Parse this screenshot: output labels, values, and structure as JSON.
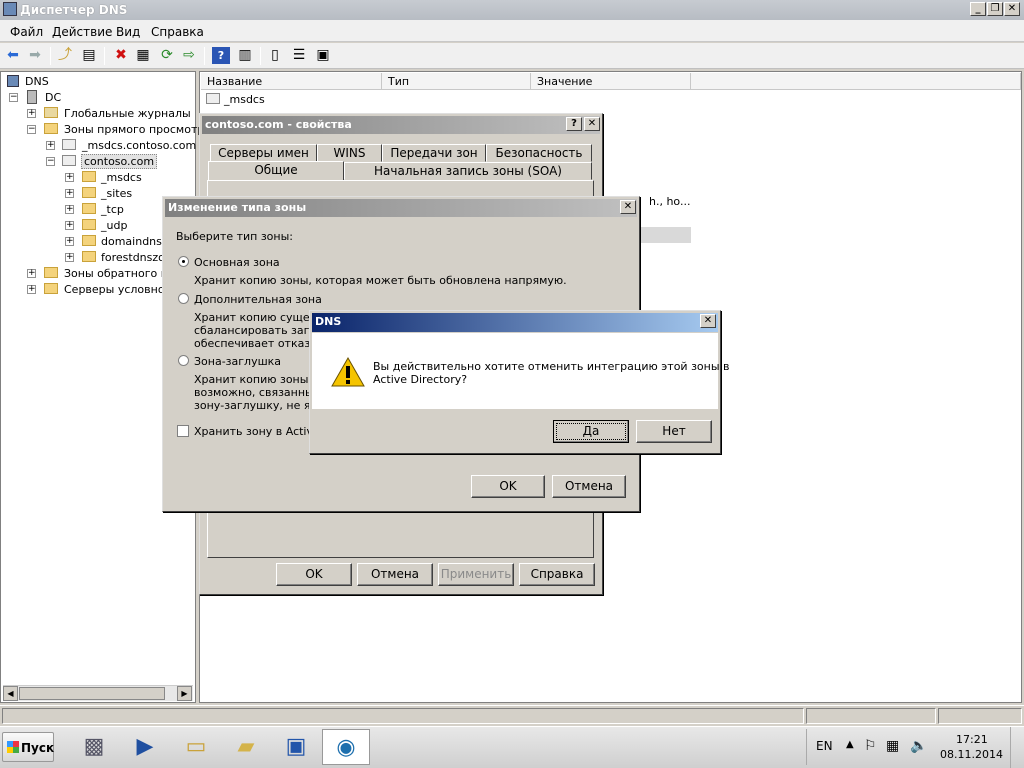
{
  "window": {
    "title": "Диспетчер DNS"
  },
  "menu": [
    "Файл",
    "Действие",
    "Вид",
    "Справка"
  ],
  "toolbar_icons": [
    "back-icon",
    "forward-icon",
    "up-folder-icon",
    "show-tree-icon",
    "delete-icon",
    "properties-icon",
    "refresh-icon",
    "export-icon",
    "help-icon",
    "view-icon",
    "server-icon",
    "list-icon",
    "record-icon"
  ],
  "tree": {
    "root": "DNS",
    "server": "DC",
    "global_logs": "Глобальные журналы",
    "forward_zones": "Зоны прямого просмотра",
    "msdcs_zone": "_msdcs.contoso.com",
    "contoso": "contoso.com",
    "children": [
      "_msdcs",
      "_sites",
      "_tcp",
      "_udp",
      "domaindnszo",
      "forestdnszor"
    ],
    "reverse_zones": "Зоны обратного про",
    "conditional": "Серверы условной"
  },
  "list": {
    "columns": [
      "Название",
      "Тип",
      "Значение"
    ],
    "rows": [
      {
        "name": "_msdcs"
      }
    ],
    "partial_value": "h., ho..."
  },
  "props_dialog": {
    "title": "contoso.com - свойства",
    "help": "?",
    "close": "✕",
    "tabs_top": [
      "Серверы имен",
      "WINS",
      "Передачи зон",
      "Безопасность"
    ],
    "tabs_bottom": [
      "Общие",
      "Начальная запись зоны (SOA)"
    ],
    "ok": "OK",
    "cancel": "Отмена",
    "apply": "Применить",
    "help_btn": "Справка"
  },
  "zone_dialog": {
    "title": "Изменение типа зоны",
    "close": "✕",
    "prompt": "Выберите тип зоны:",
    "primary": "Основная зона",
    "primary_desc": "Хранит копию зоны, которая может быть обновлена напрямую.",
    "secondary": "Дополнительная зона",
    "secondary_desc": [
      "Хранит копию существ",
      "сбалансировать загру:",
      "обеспечивает отказоу"
    ],
    "stub": "Зона-заглушка",
    "stub_desc": [
      "Хранит копию зоны, со",
      "возможно, связанные ;",
      "зону-заглушку, не явл"
    ],
    "store_ad": "Хранить зону в Active I",
    "ok": "OK",
    "cancel": "Отмена"
  },
  "confirm": {
    "title": "DNS",
    "close": "✕",
    "message_1": "Вы действительно хотите отменить интеграцию этой зоны в",
    "message_2": "Active Directory?",
    "yes": "Да",
    "no": "Нет"
  },
  "taskbar": {
    "start": "Пуск",
    "lang": "EN",
    "time": "17:21",
    "date": "08.11.2014",
    "apps": [
      "server-manager-icon",
      "powershell-icon",
      "explorer-icon",
      "folder-icon",
      "remote-desktop-icon",
      "dns-manager-icon"
    ]
  },
  "colors": {
    "title_active": "#0a246a",
    "title_inactive": "#808080",
    "folder": "#f4d37c"
  }
}
